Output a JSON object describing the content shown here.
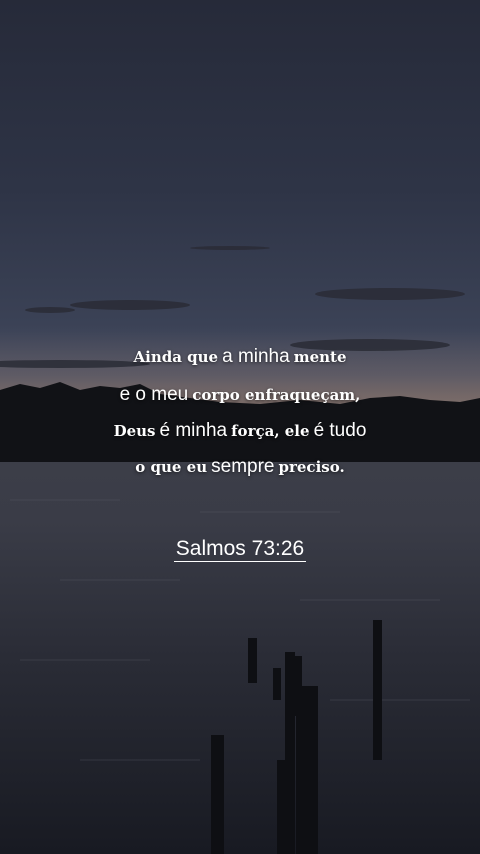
{
  "quote": {
    "line1": {
      "a": "Ainda que",
      "b": "a minha",
      "c": "mente"
    },
    "line2": {
      "a": "e o meu",
      "b": "corpo enfraqueçam,"
    },
    "line3": {
      "a": "Deus",
      "b": "é minha",
      "c": "força, ele",
      "d": "é tudo"
    },
    "line4": {
      "a": "o que eu",
      "b": "sempre",
      "c": "preciso."
    }
  },
  "reference": "Salmos 73:26",
  "colors": {
    "text": "#ffffff",
    "sky": "#2e3446",
    "water": "#1c1f2c"
  }
}
